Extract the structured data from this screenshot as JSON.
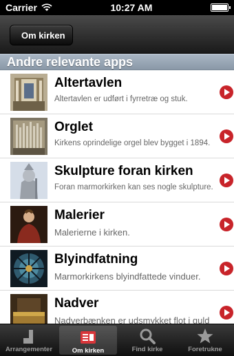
{
  "status_bar": {
    "carrier": "Carrier",
    "time": "10:27 AM"
  },
  "nav": {
    "back_label": "Om kirken"
  },
  "section": {
    "title": "Andre relevante apps"
  },
  "rows": [
    {
      "title": "Altertavlen",
      "subtitle": "Altertavlen er udført i fyrretræ og stuk.",
      "icon": "altarpiece-thumbnail"
    },
    {
      "title": "Orglet",
      "subtitle": "Kirkens oprindelige orgel blev bygget i 1894.",
      "icon": "organ-thumbnail"
    },
    {
      "title": "Skulpture foran kirken",
      "subtitle": "Foran marmorkirken kan ses nogle skulpture.",
      "icon": "sculpture-thumbnail"
    },
    {
      "title": "Malerier",
      "subtitle": "Malerierne i kirken.",
      "icon": "painting-thumbnail"
    },
    {
      "title": "Blyindfatning",
      "subtitle": "Marmorkirkens blyindfattede vinduer.",
      "icon": "stained-glass-thumbnail"
    },
    {
      "title": "Nadver",
      "subtitle": "Nadverbænken er udsmykket flot i guld",
      "icon": "communion-thumbnail"
    }
  ],
  "tabs": [
    {
      "label": "Arrangementer",
      "icon": "events-icon"
    },
    {
      "label": "Om kirken",
      "icon": "church-info-icon"
    },
    {
      "label": "Find kirke",
      "icon": "search-icon"
    },
    {
      "label": "Foretrukne",
      "icon": "star-icon"
    }
  ],
  "colors": {
    "accent_red": "#c8242a",
    "section_header": "#9aa7b5",
    "navbar": "#1a1a1a"
  }
}
